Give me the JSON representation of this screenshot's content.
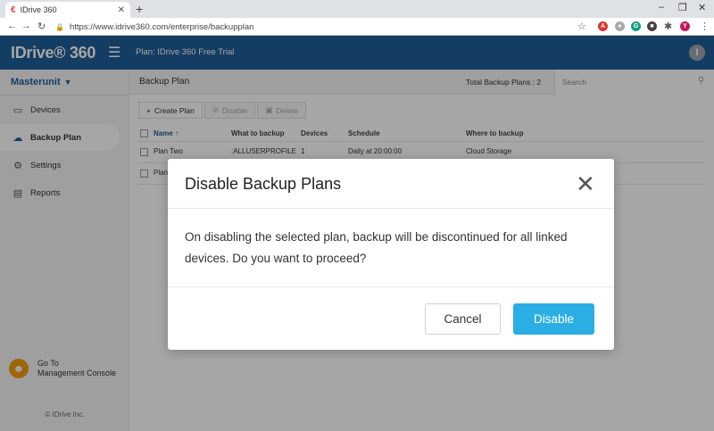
{
  "browser": {
    "tab_title": "IDrive 360",
    "url": "https://www.idrive360.com/enterprise/backupplan",
    "avatar_letter": "Y"
  },
  "header": {
    "logo": "IDrive® 360",
    "plan_label": "Plan: IDrive 360 Free Trial",
    "user_initial": "I"
  },
  "sidebar": {
    "unit": "Masterunit",
    "items": [
      {
        "label": "Devices",
        "icon": "monitor-icon"
      },
      {
        "label": "Backup Plan",
        "icon": "cloud-upload-icon"
      },
      {
        "label": "Settings",
        "icon": "gear-icon"
      },
      {
        "label": "Reports",
        "icon": "document-icon"
      }
    ],
    "goto_line1": "Go To",
    "goto_line2": "Management Console",
    "copyright": "© IDrive Inc."
  },
  "main": {
    "title": "Backup Plan",
    "total": "Total Backup Plans : 2",
    "search_placeholder": "Search",
    "toolbar": {
      "create": "Create Plan",
      "disable": "Disable",
      "delete": "Delete"
    },
    "columns": [
      "Name",
      "What to backup",
      "Devices",
      "Schedule",
      "Where to backup"
    ],
    "rows": [
      {
        "name": "Plan Two",
        "what": ":ALLUSERPROFILE",
        "devices": "1",
        "schedule": "Daily at 20:00:00",
        "where": "Cloud Storage"
      },
      {
        "name": "Plan",
        "what": "",
        "devices": "",
        "schedule": "",
        "where": ""
      }
    ]
  },
  "dialog": {
    "title": "Disable Backup Plans",
    "body": "On disabling the selected plan, backup will be discontinued for all linked devices. Do you want to proceed?",
    "cancel": "Cancel",
    "confirm": "Disable"
  },
  "colors": {
    "header_blue": "#1f5f99",
    "primary_button": "#2aaee4"
  }
}
